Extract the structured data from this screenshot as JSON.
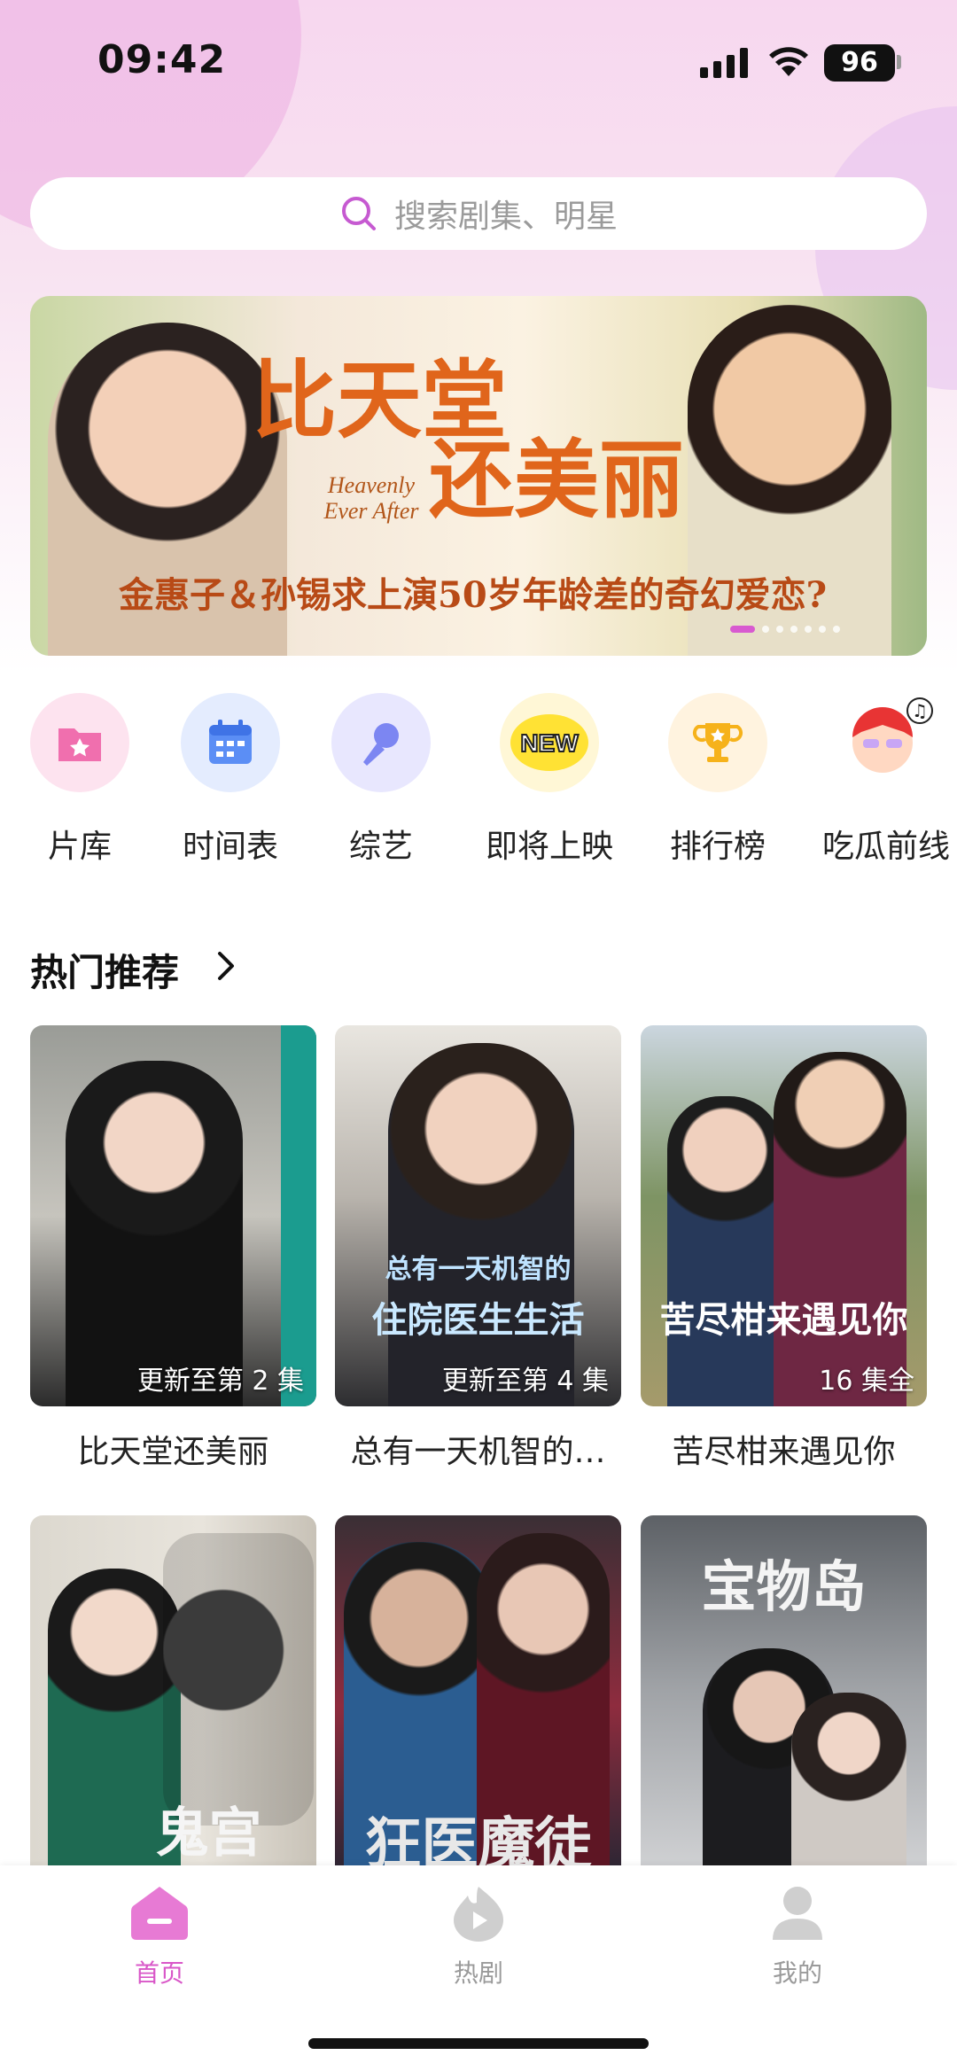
{
  "status_bar": {
    "time": "09:42",
    "battery": "96"
  },
  "search": {
    "placeholder": "搜索剧集、明星"
  },
  "banner": {
    "title_line1": "比天堂",
    "title_line2": "还美丽",
    "title_en": "Heavenly Ever After",
    "subtitle": "金惠子＆孙锡求上演50岁年龄差的奇幻爱恋?",
    "active_index": 0,
    "total": 7
  },
  "categories": [
    {
      "label": "片库",
      "icon": "folder-star-icon"
    },
    {
      "label": "时间表",
      "icon": "calendar-icon"
    },
    {
      "label": "综艺",
      "icon": "microphone-icon"
    },
    {
      "label": "即将上映",
      "icon": "new-badge-icon"
    },
    {
      "label": "排行榜",
      "icon": "trophy-icon"
    },
    {
      "label": "吃瓜前线",
      "icon": "avatar-music-icon"
    }
  ],
  "section": {
    "title": "热门推荐"
  },
  "shows": [
    {
      "title": "比天堂还美丽",
      "badge": "更新至第 2 集"
    },
    {
      "title": "总有一天机智的…",
      "badge": "更新至第 4 集",
      "poster_text1": "总有一天机智的",
      "poster_text2": "住院医生生活"
    },
    {
      "title": "苦尽柑来遇见你",
      "badge": "16 集全",
      "poster_text1": "苦尽柑来遇见你"
    },
    {
      "title": "",
      "badge": "",
      "poster_text1": "鬼宫"
    },
    {
      "title": "",
      "badge": "",
      "poster_text1": "狂医魔徒"
    },
    {
      "title": "",
      "badge": "",
      "poster_text1": "宝物岛"
    }
  ],
  "bottom_nav": [
    {
      "label": "首页",
      "active": true
    },
    {
      "label": "热剧",
      "active": false
    },
    {
      "label": "我的",
      "active": false
    }
  ],
  "colors": {
    "accent": "#d957c8",
    "banner_title": "#e0651b"
  }
}
